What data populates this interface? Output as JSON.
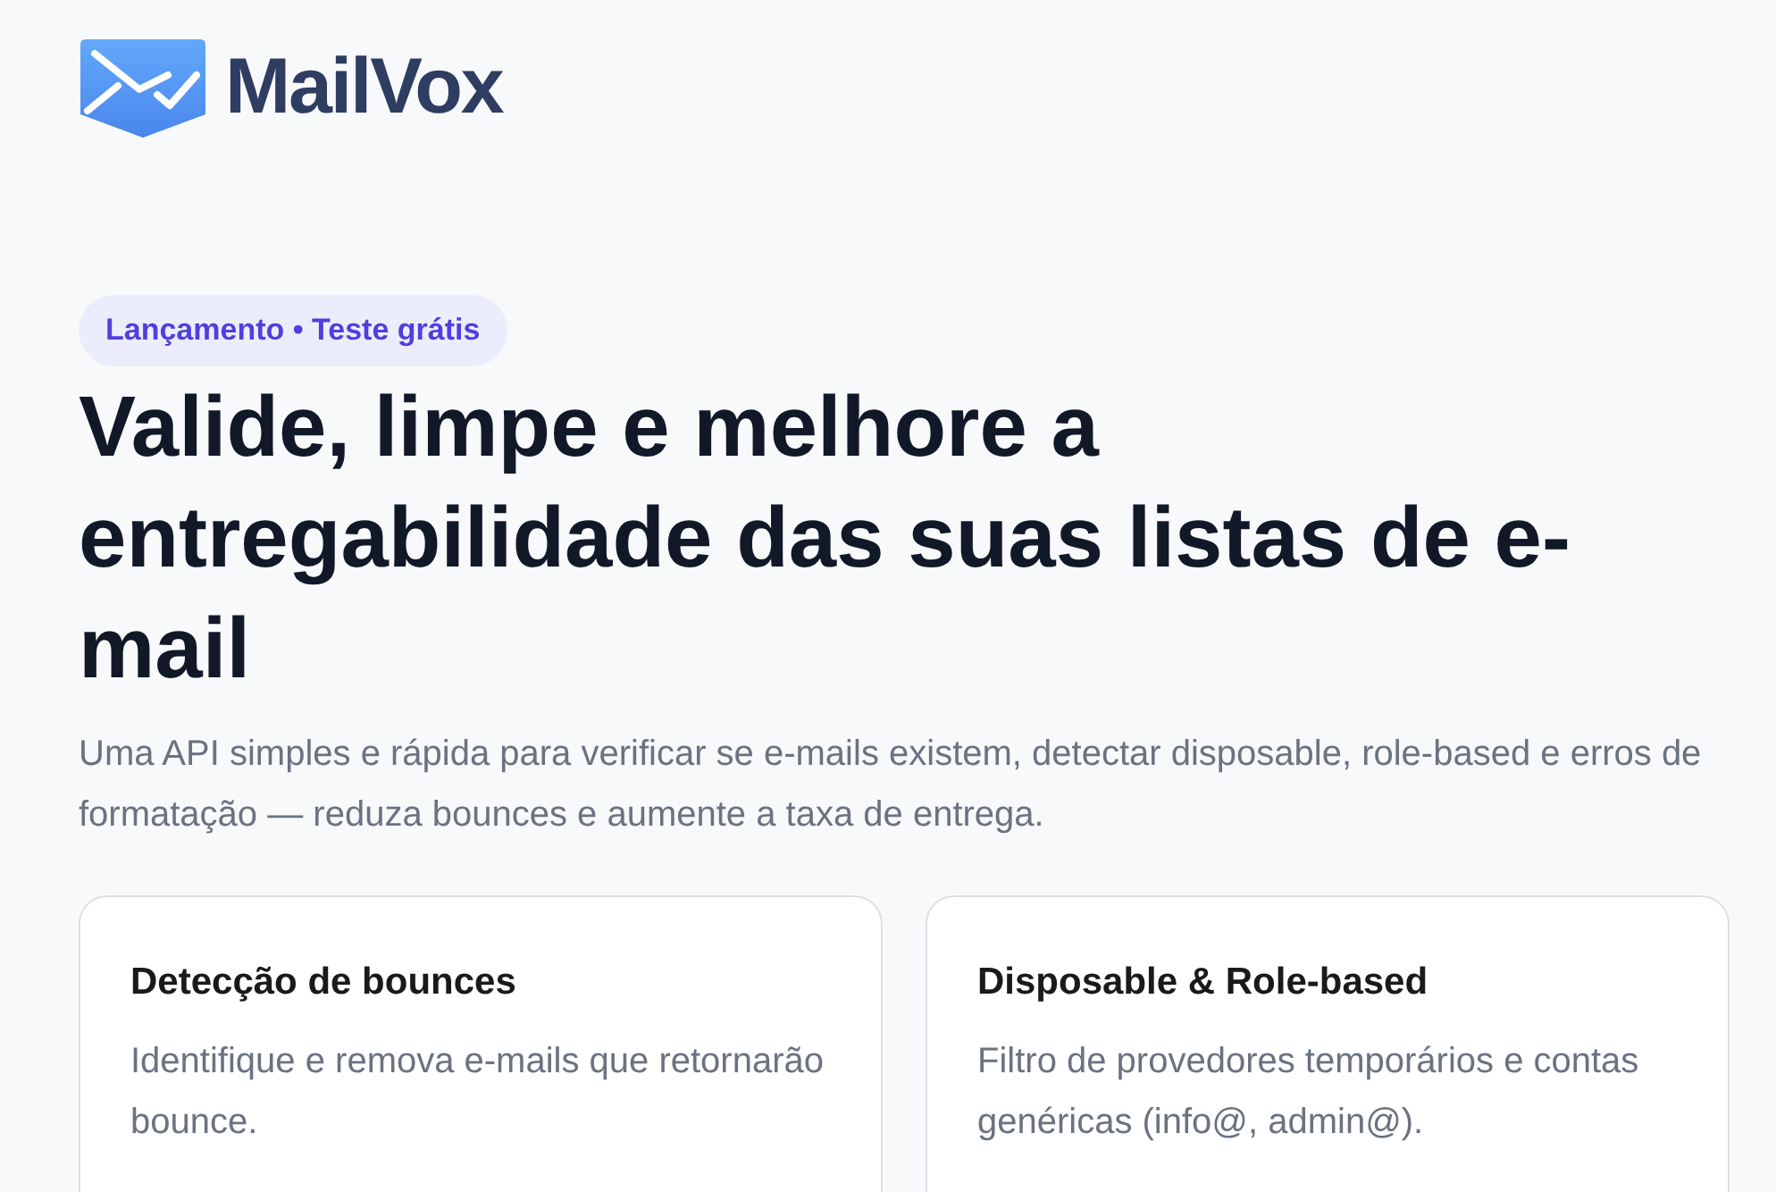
{
  "brand": {
    "name": "MailVox"
  },
  "hero": {
    "badge": "Lançamento • Teste grátis",
    "title": "Valide, limpe e melhore a entregabilidade das suas listas de e-mail",
    "subtitle": "Uma API simples e rápida para verificar se e-mails existem, detectar disposable, role-based e erros de formatação — reduza bounces e aumente a taxa de entrega."
  },
  "features": [
    {
      "title": "Detecção de bounces",
      "description": "Identifique e remova e-mails que retornarão bounce."
    },
    {
      "title": "Disposable & Role-based",
      "description": "Filtro de provedores temporários e contas genéricas (info@, admin@)."
    }
  ]
}
